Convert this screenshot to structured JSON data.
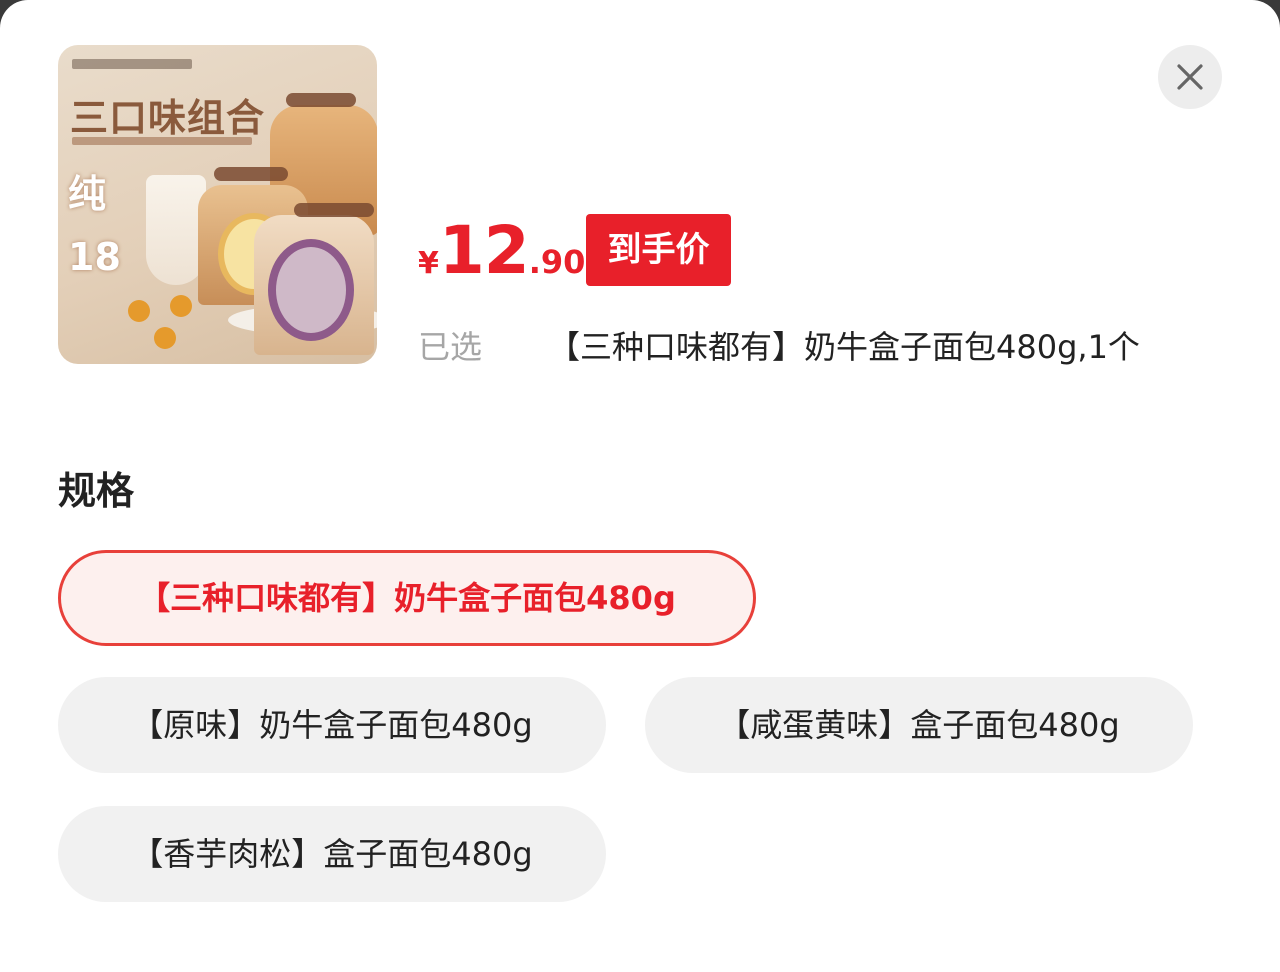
{
  "product": {
    "image_alt": "product-image",
    "image_text": {
      "headline": "三口味组合",
      "pure": "纯",
      "number": "18"
    }
  },
  "price": {
    "currency": "¥",
    "integer": "12",
    "decimal": ".90",
    "tag": "到手价"
  },
  "selection": {
    "label": "已选",
    "value": "【三种口味都有】奶牛盒子面包480g,1个"
  },
  "spec": {
    "title": "规格",
    "options": [
      {
        "label": "【三种口味都有】奶牛盒子面包480g",
        "selected": true
      },
      {
        "label": "【原味】奶牛盒子面包480g",
        "selected": false
      },
      {
        "label": "【咸蛋黄味】盒子面包480g",
        "selected": false
      },
      {
        "label": "【香芋肉松】盒子面包480g",
        "selected": false
      }
    ]
  },
  "colors": {
    "accent": "#e8202a",
    "selected_bg": "#fdf0ee",
    "option_bg": "#f1f1f1"
  }
}
